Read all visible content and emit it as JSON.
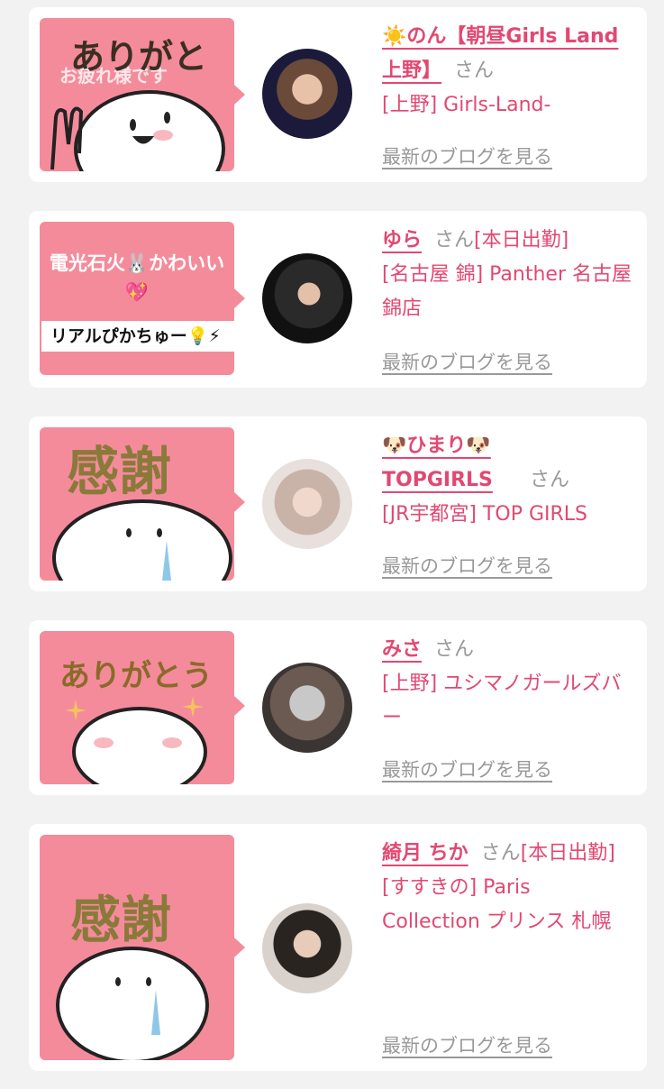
{
  "cards": [
    {
      "name": "☀️のん【朝昼Girls Land上野】",
      "suffix": "さん",
      "shop": "[上野] Girls-Land-",
      "blog_link": "最新のブログを見る",
      "thumb_text": "ありがと",
      "thumb_subtext": "お疲れ様です"
    },
    {
      "name": "ゆら",
      "suffix": "さん",
      "suffix_extra": "[本日出勤]",
      "shop": "[名古屋 錦] Panther 名古屋錦店",
      "blog_link": "最新のブログを見る",
      "thumb_text": "電光石火🐰かわいい💖",
      "thumb_subtext": "リアルぴかちゅー💡⚡"
    },
    {
      "name": "🐶ひまり🐶TOPGIRLS",
      "suffix": "さん",
      "shop": "[JR宇都宮] TOP GIRLS",
      "blog_link": "最新のブログを見る",
      "thumb_text": "感謝"
    },
    {
      "name": "みさ",
      "suffix": "さん",
      "shop": "[上野] ユシマノガールズバー",
      "blog_link": "最新のブログを見る",
      "thumb_text": "ありがとう"
    },
    {
      "name": "綺月 ちか",
      "suffix": "さん",
      "suffix_extra": "[本日出勤]",
      "shop": "[すすきの] Paris Collection プリンス 札幌",
      "blog_link": "最新のブログを見る",
      "thumb_text": "感謝"
    }
  ],
  "colors": {
    "accent": "#e24872",
    "thumb_bg": "#f48b9b",
    "muted": "#999999",
    "page_bg": "#f2f2f2"
  }
}
